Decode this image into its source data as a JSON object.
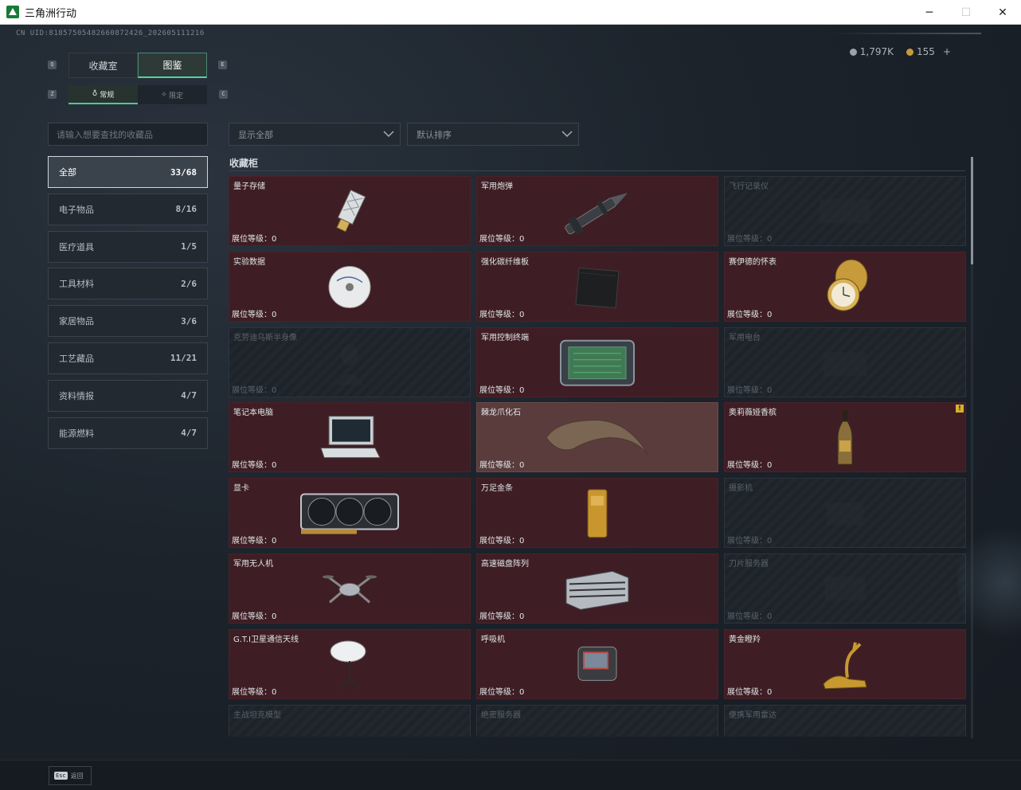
{
  "window": {
    "title": "三角洲行动",
    "minimize": "─",
    "maximize": "☐",
    "close": "✕"
  },
  "header": {
    "uid": "CN UID:8185750548266087242​6_202605111216",
    "silver": "1,797K",
    "gold": "155",
    "plus": "+"
  },
  "tabs": [
    {
      "label": "收藏室",
      "key": "Q"
    },
    {
      "label": "图鉴",
      "key": "E"
    }
  ],
  "subtabs": [
    {
      "label": "常规",
      "key": "Z"
    },
    {
      "label": "限定",
      "key": "C"
    }
  ],
  "search": {
    "placeholder": "请输入想要查找的收藏品"
  },
  "categories": [
    {
      "label": "全部",
      "count": "33/68"
    },
    {
      "label": "电子物品",
      "count": "8/16"
    },
    {
      "label": "医疗道具",
      "count": "1/5"
    },
    {
      "label": "工具材料",
      "count": "2/6"
    },
    {
      "label": "家居物品",
      "count": "3/6"
    },
    {
      "label": "工艺藏品",
      "count": "11/21"
    },
    {
      "label": "资料情报",
      "count": "4/7"
    },
    {
      "label": "能源燃料",
      "count": "4/7"
    }
  ],
  "filters": {
    "display": "显示全部",
    "sort": "默认排序"
  },
  "section": {
    "title": "收藏柜"
  },
  "level_prefix": "展位等级：",
  "items": [
    {
      "name": "量子存储",
      "level": "0",
      "icon": "usb-drive-icon",
      "state": "owned"
    },
    {
      "name": "军用炮弹",
      "level": "0",
      "icon": "artillery-shell-icon",
      "state": "owned"
    },
    {
      "name": "飞行记录仪",
      "level": "0",
      "icon": "flight-recorder-icon",
      "state": "locked"
    },
    {
      "name": "实验数据",
      "level": "0",
      "icon": "disc-icon",
      "state": "owned"
    },
    {
      "name": "强化碳纤维板",
      "level": "0",
      "icon": "carbon-plate-icon",
      "state": "owned"
    },
    {
      "name": "赛伊德的怀表",
      "level": "0",
      "icon": "pocket-watch-icon",
      "state": "owned"
    },
    {
      "name": "克劳迪乌斯半身像",
      "level": "0",
      "icon": "bust-icon",
      "state": "locked"
    },
    {
      "name": "军用控制终端",
      "level": "0",
      "icon": "control-terminal-icon",
      "state": "owned"
    },
    {
      "name": "军用电台",
      "level": "0",
      "icon": "radio-icon",
      "state": "locked"
    },
    {
      "name": "笔记本电脑",
      "level": "0",
      "icon": "laptop-icon",
      "state": "owned"
    },
    {
      "name": "棘龙爪化石",
      "level": "0",
      "icon": "claw-fossil-icon",
      "state": "highlight"
    },
    {
      "name": "奥莉薇娅香槟",
      "level": "0",
      "icon": "champagne-icon",
      "state": "owned",
      "badge": "!"
    },
    {
      "name": "显卡",
      "level": "0",
      "icon": "graphics-card-icon",
      "state": "owned"
    },
    {
      "name": "万足金条",
      "level": "0",
      "icon": "gold-bar-icon",
      "state": "owned"
    },
    {
      "name": "摄影机",
      "level": "0",
      "icon": "camera-icon",
      "state": "locked"
    },
    {
      "name": "军用无人机",
      "level": "0",
      "icon": "drone-icon",
      "state": "owned"
    },
    {
      "name": "高速磁盘阵列",
      "level": "0",
      "icon": "disk-array-icon",
      "state": "owned"
    },
    {
      "name": "刀片服务器",
      "level": "0",
      "icon": "blade-server-icon",
      "state": "locked"
    },
    {
      "name": "G.T.I卫星通信天线",
      "level": "0",
      "icon": "satellite-dish-icon",
      "state": "owned"
    },
    {
      "name": "呼吸机",
      "level": "0",
      "icon": "ventilator-icon",
      "state": "owned"
    },
    {
      "name": "黄金瞪羚",
      "level": "0",
      "icon": "golden-gazelle-icon",
      "state": "owned"
    },
    {
      "name": "主战坦克模型",
      "level": "",
      "icon": "tank-model-icon",
      "state": "locked"
    },
    {
      "name": "绝密服务器",
      "level": "",
      "icon": "server-icon",
      "state": "locked"
    },
    {
      "name": "便携军用雷达",
      "level": "",
      "icon": "radar-icon",
      "state": "locked"
    }
  ],
  "bottom": {
    "esc_key": "Esc",
    "esc_label": "返回"
  }
}
